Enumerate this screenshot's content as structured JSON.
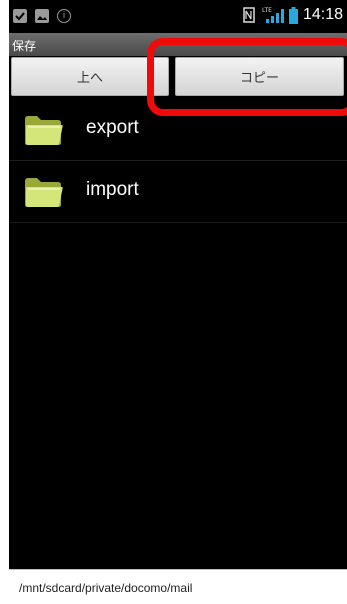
{
  "status_bar": {
    "icons": [
      "checkbox-icon",
      "image-icon",
      "info-icon",
      "nfc-icon",
      "signal-icon",
      "battery-icon"
    ],
    "signal_label": "LTE",
    "time": "14:18"
  },
  "title_bar": {
    "title": "保存"
  },
  "toolbar": {
    "up_label": "上へ",
    "copy_label": "コピー"
  },
  "folders": [
    {
      "name": "export"
    },
    {
      "name": "import"
    }
  ],
  "path_bar": {
    "path": "/mnt/sdcard/private/docomo/mail"
  },
  "colors": {
    "highlight": "#f00a0a",
    "folder": "#cfe06a"
  }
}
